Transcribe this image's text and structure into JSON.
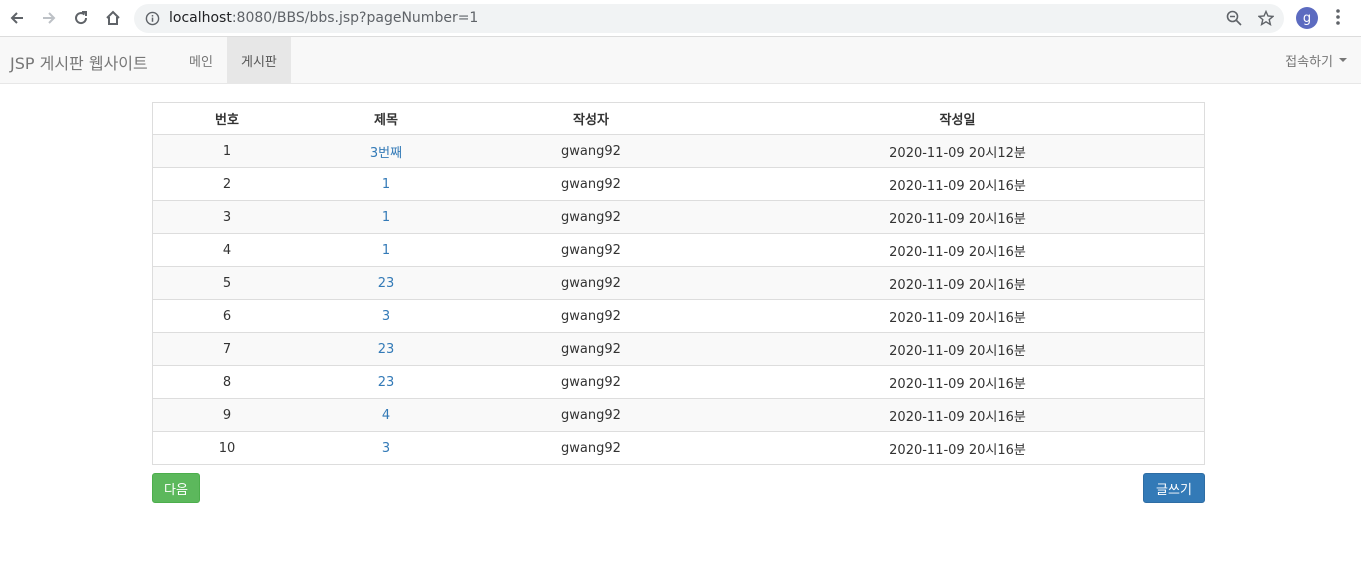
{
  "browser": {
    "url_host": "localhost",
    "url_path": ":8080/BBS/bbs.jsp?pageNumber=1",
    "profile_initial": "g"
  },
  "navbar": {
    "brand": "JSP 게시판 웹사이트",
    "links": [
      {
        "label": "메인",
        "active": false
      },
      {
        "label": "게시판",
        "active": true
      }
    ],
    "right_menu": "접속하기"
  },
  "board": {
    "headers": [
      "번호",
      "제목",
      "작성자",
      "작성일"
    ],
    "rows": [
      {
        "no": "1",
        "title": "3번째",
        "author": "gwang92",
        "date": "2020-11-09 20시12분"
      },
      {
        "no": "2",
        "title": "1",
        "author": "gwang92",
        "date": "2020-11-09 20시16분"
      },
      {
        "no": "3",
        "title": "1",
        "author": "gwang92",
        "date": "2020-11-09 20시16분"
      },
      {
        "no": "4",
        "title": "1",
        "author": "gwang92",
        "date": "2020-11-09 20시16분"
      },
      {
        "no": "5",
        "title": "23",
        "author": "gwang92",
        "date": "2020-11-09 20시16분"
      },
      {
        "no": "6",
        "title": "3",
        "author": "gwang92",
        "date": "2020-11-09 20시16분"
      },
      {
        "no": "7",
        "title": "23",
        "author": "gwang92",
        "date": "2020-11-09 20시16분"
      },
      {
        "no": "8",
        "title": "23",
        "author": "gwang92",
        "date": "2020-11-09 20시16분"
      },
      {
        "no": "9",
        "title": "4",
        "author": "gwang92",
        "date": "2020-11-09 20시16분"
      },
      {
        "no": "10",
        "title": "3",
        "author": "gwang92",
        "date": "2020-11-09 20시16분"
      }
    ]
  },
  "buttons": {
    "next": "다음",
    "write": "글쓰기"
  }
}
